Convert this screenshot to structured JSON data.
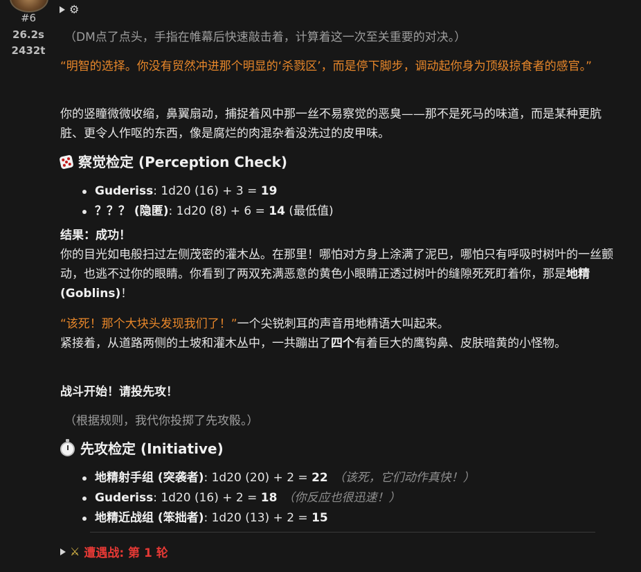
{
  "message": {
    "index": "#6",
    "duration": "26.2s",
    "tokens": "2432t"
  },
  "icons": {
    "settings": "gear-icon",
    "expand": "expand-triangle-icon",
    "dice": "dice-icon",
    "stopwatch": "stopwatch-icon",
    "swords": "crossed-swords-icon"
  },
  "body": {
    "dm_note_1": "（DM点了点头，手指在帷幕后快速敲击着，计算着这一次至关重要的对决。）",
    "quote_1": "“明智的选择。你没有贸然冲进那个明显的‘杀戮区’，而是停下脚步，调动起你身为顶级掠食者的感官。”",
    "para_1": "你的竖瞳微微收缩，鼻翼扇动，捕捉着风中那一丝不易察觉的恶臭——那不是死马的味道，而是某种更肮脏、更令人作呕的东西，像是腐烂的肉混杂着没洗过的皮甲味。",
    "perception": {
      "heading": "察觉检定 (Perception Check)",
      "rows": [
        {
          "name": "Guderiss",
          "rest": ": 1d20 (16) + 3 = ",
          "total": "19",
          "extra": ""
        },
        {
          "name": "？？？ (隐匿)",
          "rest": ": 1d20 (8) + 6 = ",
          "total": "14",
          "extra": " (最低值)"
        }
      ]
    },
    "result_label": "结果：成功！",
    "para_2a": "你的目光如电般扫过左侧茂密的灌木丛。在那里！哪怕对方身上涂满了泥巴，哪怕只有呼吸时树叶的一丝颤动，也逃不过你的眼睛。你看到了两双充满恶意的黄色小眼睛正透过树叶的缝隙死死盯着你，那是",
    "para_2b": "地精 (Goblins)",
    "para_2c": "！",
    "quote_2": "“该死！那个大块头发现我们了！”",
    "para_3a": "一个尖锐刺耳的声音用地精语大叫起来。",
    "para_3b": "紧接着，从道路两侧的土坡和灌木丛中，一共蹦出了",
    "para_3c": "四个",
    "para_3d": "有着巨大的鹰钩鼻、皮肤暗黄的小怪物。",
    "combat_start": "战斗开始！请投先攻！",
    "dm_note_2": "（根据规则，我代你投掷了先攻骰。）",
    "initiative": {
      "heading": "先攻检定 (Initiative)",
      "rows": [
        {
          "name": "地精射手组 (突袭者)",
          "rest": ": 1d20 (20) + 2 = ",
          "total": "22",
          "note": "（该死，它们动作真快！）"
        },
        {
          "name": "Guderiss",
          "rest": ": 1d20 (16) + 2 = ",
          "total": "18",
          "note": "（你反应也很迅速！）"
        },
        {
          "name": "地精近战组 (笨拙者)",
          "rest": ": 1d20 (13) + 2 = ",
          "total": "15",
          "note": ""
        }
      ]
    },
    "encounter": "遭遇战: 第 1 轮"
  }
}
